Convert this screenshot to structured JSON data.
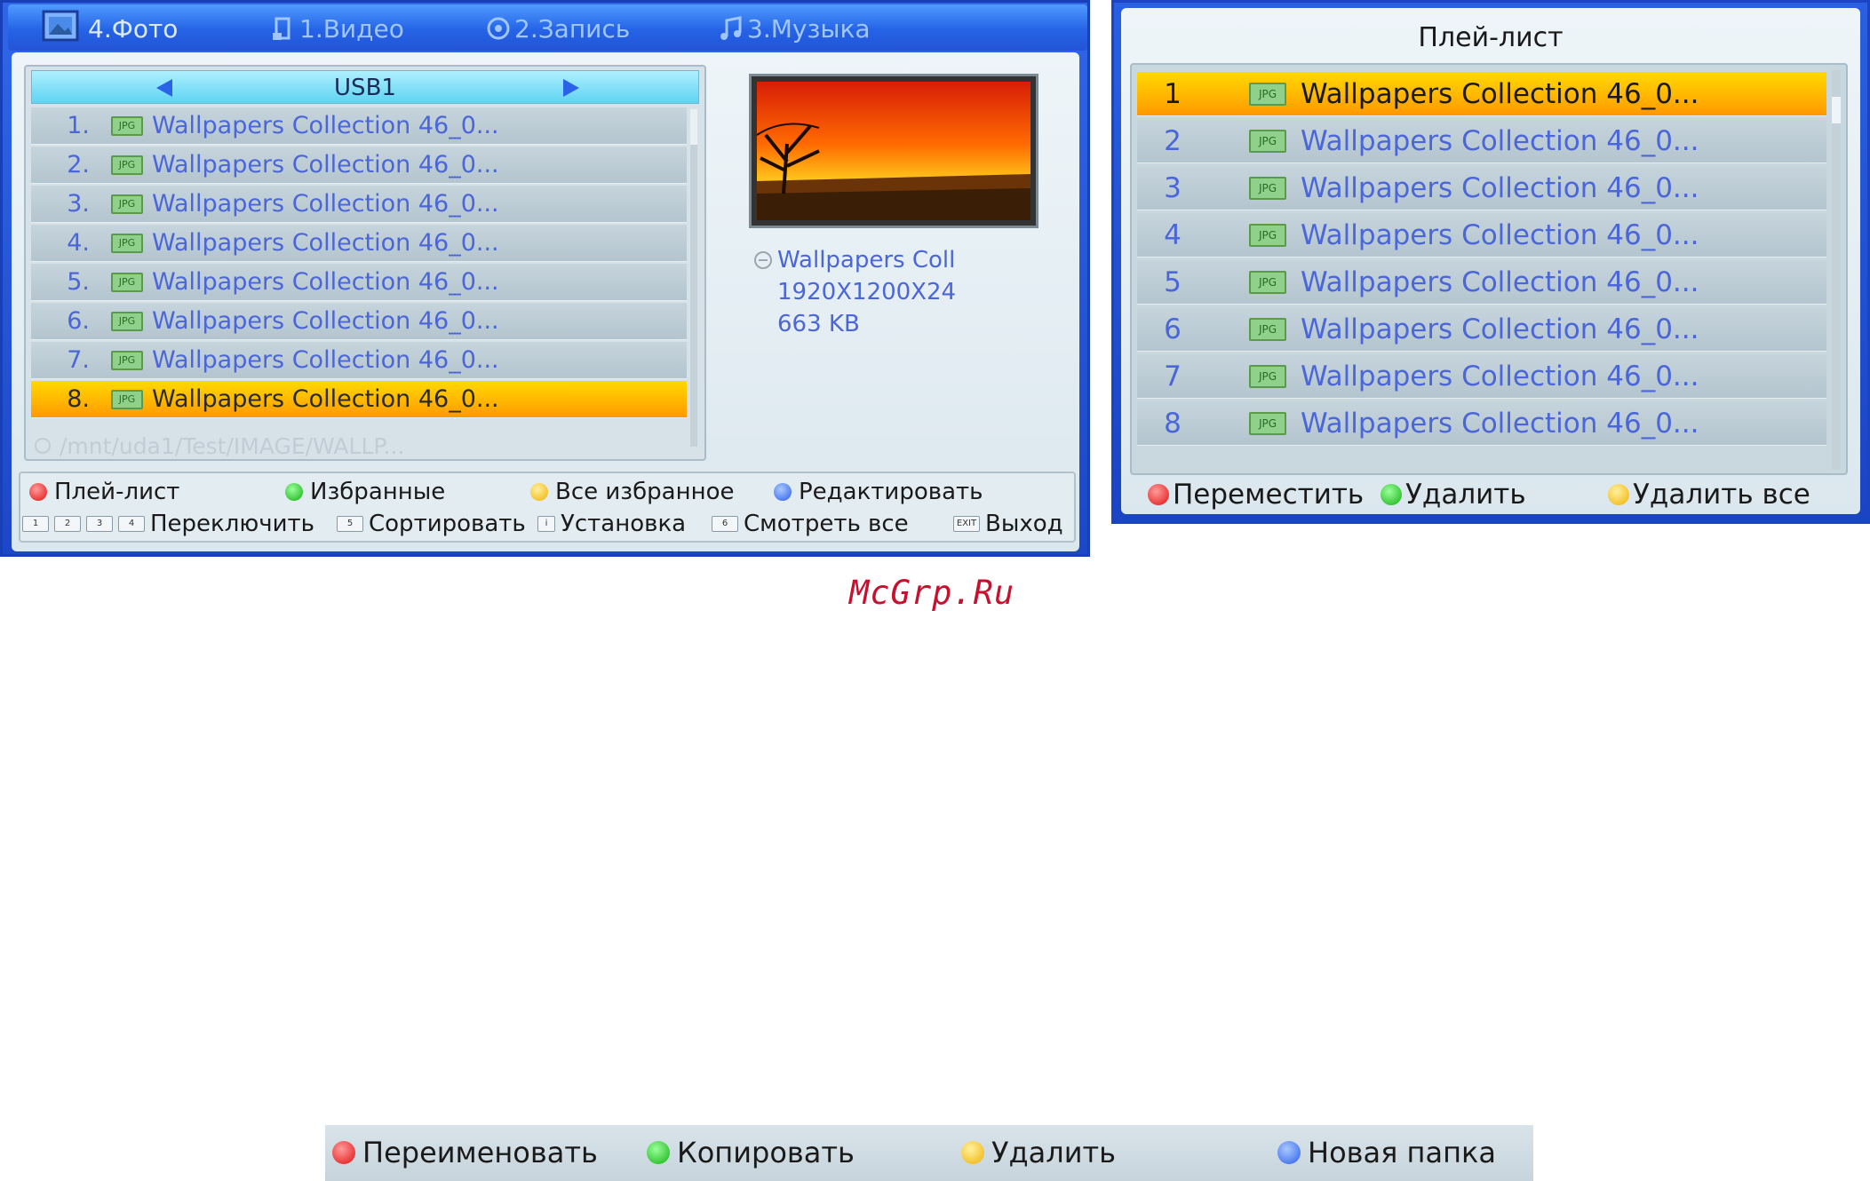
{
  "left_screen": {
    "tabs": [
      {
        "label": "4.Фото",
        "icon": "photo-icon",
        "active": true
      },
      {
        "label": "1.Видео",
        "icon": "video-icon",
        "active": false
      },
      {
        "label": "2.Запись",
        "icon": "record-icon",
        "active": false
      },
      {
        "label": "3.Музыка",
        "icon": "music-icon",
        "active": false
      }
    ],
    "device": "USB1",
    "files": [
      {
        "num": "1.",
        "name": "Wallpapers Collection 46_0..."
      },
      {
        "num": "2.",
        "name": "Wallpapers Collection 46_0..."
      },
      {
        "num": "3.",
        "name": "Wallpapers Collection 46_0..."
      },
      {
        "num": "4.",
        "name": "Wallpapers Collection 46_0..."
      },
      {
        "num": "5.",
        "name": "Wallpapers Collection 46_0..."
      },
      {
        "num": "6.",
        "name": "Wallpapers Collection 46_0..."
      },
      {
        "num": "7.",
        "name": "Wallpapers Collection 46_0..."
      },
      {
        "num": "8.",
        "name": "Wallpapers Collection 46_0..."
      }
    ],
    "selected_index": 7,
    "file_type_label": "JPG",
    "path": "/mnt/uda1/Test/IMAGE/WALLP...",
    "info": {
      "name": "Wallpapers Coll",
      "resolution": "1920X1200X24",
      "size": "663 KB"
    },
    "footer": {
      "red": "Плей-лист",
      "green": "Избранные",
      "yellow": "Все избранное",
      "blue": "Редактировать",
      "keys_switch": [
        "1",
        "2",
        "3",
        "4"
      ],
      "switch_label": "Переключить",
      "key_sort": "5",
      "sort_label": "Сортировать",
      "key_setup": "i",
      "setup_label": "Установка",
      "key_viewall": "6",
      "viewall_label": "Смотреть все",
      "key_exit": "EXIT",
      "exit_label": "Выход"
    }
  },
  "right_screen": {
    "title": "Плей-лист",
    "items": [
      {
        "num": "1",
        "name": "Wallpapers Collection 46_0..."
      },
      {
        "num": "2",
        "name": "Wallpapers Collection 46_0..."
      },
      {
        "num": "3",
        "name": "Wallpapers Collection 46_0..."
      },
      {
        "num": "4",
        "name": "Wallpapers Collection 46_0..."
      },
      {
        "num": "5",
        "name": "Wallpapers Collection 46_0..."
      },
      {
        "num": "6",
        "name": "Wallpapers Collection 46_0..."
      },
      {
        "num": "7",
        "name": "Wallpapers Collection 46_0..."
      },
      {
        "num": "8",
        "name": "Wallpapers Collection 46_0..."
      }
    ],
    "selected_index": 0,
    "file_type_label": "JPG",
    "footer": {
      "red": "Переместить",
      "green": "Удалить",
      "yellow": "Удалить все"
    }
  },
  "watermark": "McGrp.Ru",
  "bottom_bar": {
    "red": "Переименовать",
    "green": "Копировать",
    "yellow": "Удалить",
    "blue": "Новая папка"
  },
  "colors": {
    "selection": "#ffb300",
    "frame_blue": "#1c47c8",
    "text_blue": "#4a66d8",
    "watermark_red": "#c8102e"
  }
}
